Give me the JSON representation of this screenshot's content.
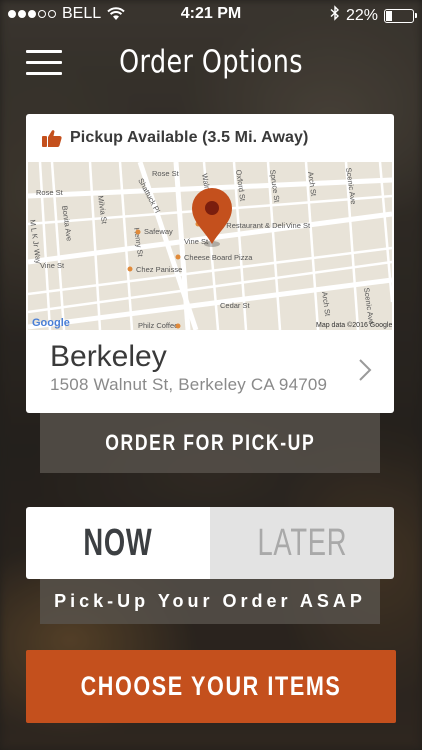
{
  "status_bar": {
    "carrier": "BELL",
    "time": "4:21 PM",
    "battery_percent": "22%",
    "battery_level": 0.22,
    "signal_bars_filled": 3,
    "signal_bars_total": 5
  },
  "header": {
    "title": "Order Options",
    "menu_icon": "hamburger-menu-icon"
  },
  "location_card": {
    "pickup_text": "Pickup Available (3.5 Mi. Away)",
    "pickup_icon": "thumbs-up-icon",
    "map": {
      "street_labels": [
        "Rose St",
        "Rose St",
        "Shattuck Pl",
        "Walnut St",
        "Oxford St",
        "Spruce St",
        "Arch St",
        "Scenic Ave",
        "Bonita Ave",
        "Milvia St",
        "Henry St",
        "Vine St",
        "Vine St",
        "Vine St",
        "M L K Jr Way",
        "Cedar St",
        "Arch St",
        "Scenic Ave"
      ],
      "places": [
        "Saul's Restaurant & Deli",
        "Safeway",
        "Cheese Board Pizza",
        "Chez Panisse",
        "Philz Coffee"
      ],
      "logo_text": "Google",
      "attribution": "Map data ©2016 Google"
    },
    "city": "Berkeley",
    "address": "1508 Walnut St, Berkeley CA 94709",
    "chevron_icon": "chevron-right-icon"
  },
  "order_mode_label": "ORDER FOR PICK-UP",
  "time_toggle": {
    "now_label": "NOW",
    "later_label": "LATER",
    "selected": "NOW"
  },
  "asap_text": "Pick-Up Your Order ASAP",
  "cta_label": "CHOOSE YOUR ITEMS",
  "colors": {
    "accent": "#c4501d",
    "pin": "#c4501d",
    "card_bg": "#ffffff",
    "toggle_inactive_bg": "#e3e3e3"
  }
}
